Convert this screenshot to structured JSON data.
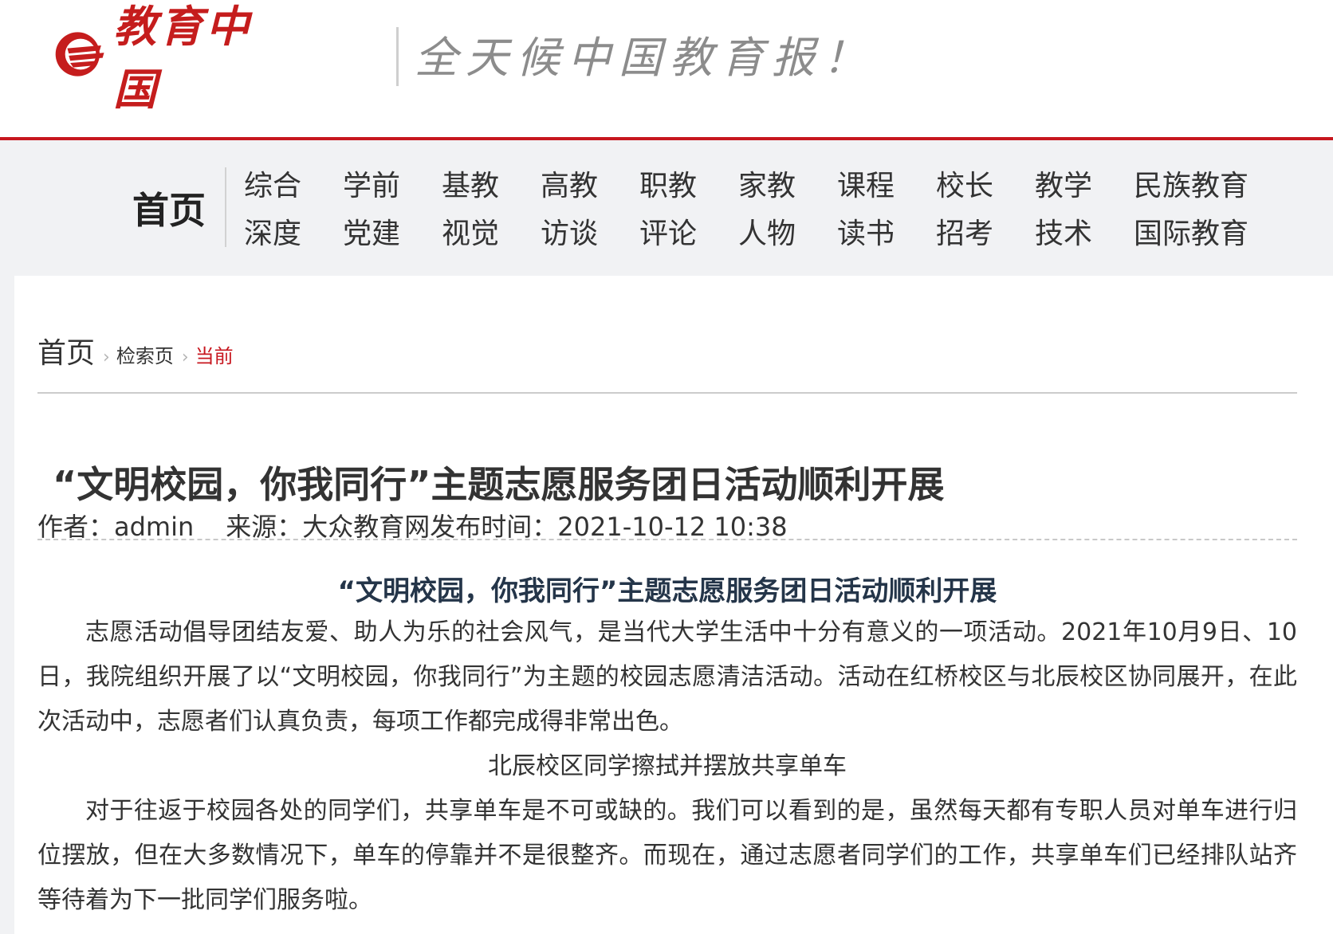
{
  "header": {
    "logo_text": "教育中国",
    "slogan": "全天候中国教育报！"
  },
  "nav": {
    "home": "首页",
    "row1": [
      "综合",
      "学前",
      "基教",
      "高教",
      "职教",
      "家教",
      "课程",
      "校长",
      "教学",
      "民族教育"
    ],
    "row2": [
      "深度",
      "党建",
      "视觉",
      "访谈",
      "评论",
      "人物",
      "读书",
      "招考",
      "技术",
      "国际教育"
    ]
  },
  "breadcrumb": {
    "home": "首页",
    "search": "检索页",
    "current": "当前"
  },
  "article": {
    "title": "“文明校园，你我同行”主题志愿服务团日活动顺利开展",
    "author": "作者：admin",
    "source_time": "来源：大众教育网发布时间：2021-10-12 10:38",
    "body_title": "“文明校园，你我同行”主题志愿服务团日活动顺利开展",
    "paragraph1": "志愿活动倡导团结友爱、助人为乐的社会风气，是当代大学生活中十分有意义的一项活动。2021年10月9日、10日，我院组织开展了以“文明校园，你我同行”为主题的校园志愿清洁活动。活动在红桥校区与北辰校区协同展开，在此次活动中，志愿者们认真负责，每项工作都完成得非常出色。",
    "caption1": "北辰校区同学擦拭并摆放共享单车",
    "paragraph2": "对于往返于校园各处的同学们，共享单车是不可或缺的。我们可以看到的是，虽然每天都有专职人员对单车进行归位摆放，但在大多数情况下，单车的停靠并不是很整齐。而现在，通过志愿者同学们的工作，共享单车们已经排队站齐等待着为下一批同学们服务啦。"
  },
  "colors": {
    "brand_red": "#c7161e",
    "nav_bg": "#f1f2f4",
    "body_title": "#243549"
  }
}
